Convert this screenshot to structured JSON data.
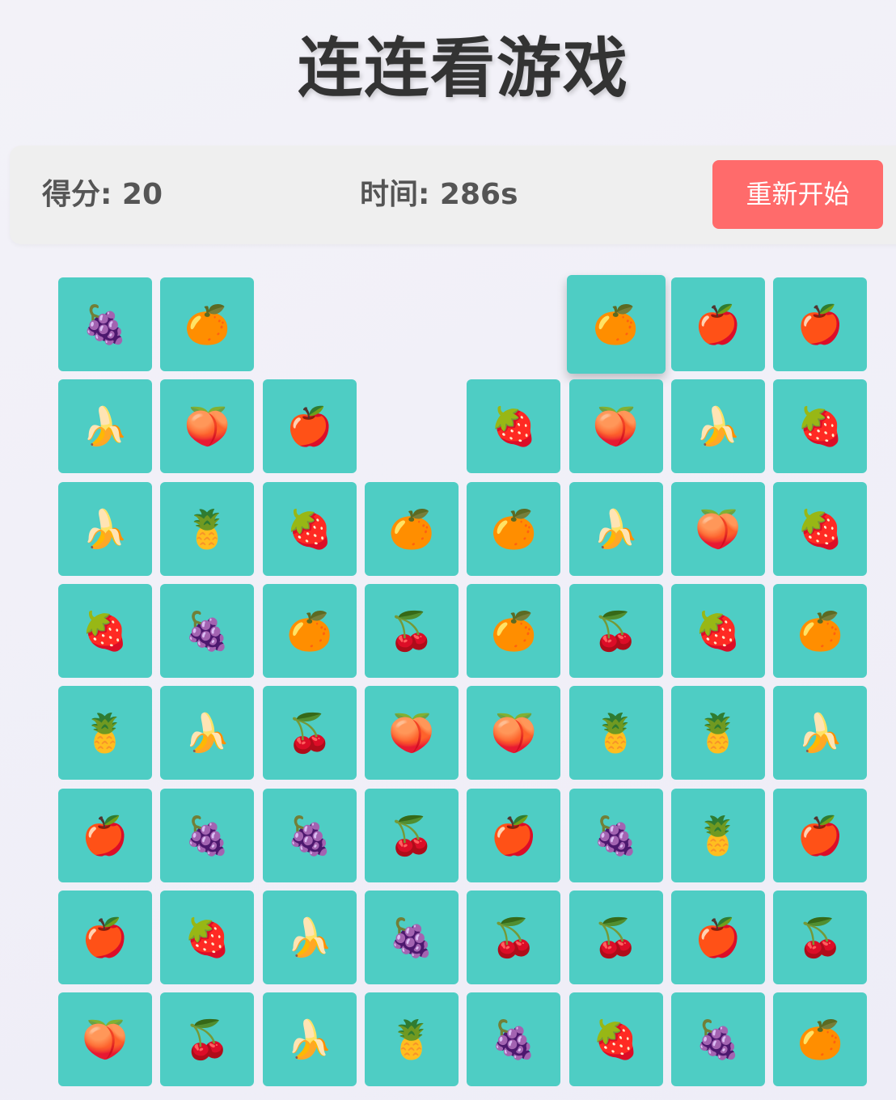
{
  "title": "连连看游戏",
  "score": {
    "label": "得分",
    "value": "20",
    "text": "得分: 20"
  },
  "timer": {
    "label": "时间",
    "value": "286s",
    "text": "时间: 286s"
  },
  "restart_button": {
    "label": "重新开始",
    "color": "#ff6b6b"
  },
  "tile_color": "#4ecdc4",
  "fruits": {
    "grapes": "🍇",
    "orange": "🍊",
    "apple": "🍎",
    "banana": "🍌",
    "peach": "🍑",
    "strawberry": "🍓",
    "pineapple": "🍍",
    "cherries": "🍒"
  },
  "board": {
    "rows": 8,
    "cols": 8,
    "selected": [
      0,
      5
    ],
    "grid": [
      [
        "grapes",
        "orange",
        null,
        null,
        null,
        "orange",
        "apple",
        "apple"
      ],
      [
        "banana",
        "peach",
        "apple",
        null,
        "strawberry",
        "peach",
        "banana",
        "strawberry"
      ],
      [
        "banana",
        "pineapple",
        "strawberry",
        "orange",
        "orange",
        "banana",
        "peach",
        "strawberry"
      ],
      [
        "strawberry",
        "grapes",
        "orange",
        "cherries",
        "orange",
        "cherries",
        "strawberry",
        "orange"
      ],
      [
        "pineapple",
        "banana",
        "cherries",
        "peach",
        "peach",
        "pineapple",
        "pineapple",
        "banana"
      ],
      [
        "apple",
        "grapes",
        "grapes",
        "cherries",
        "apple",
        "grapes",
        "pineapple",
        "apple"
      ],
      [
        "apple",
        "strawberry",
        "banana",
        "grapes",
        "cherries",
        "cherries",
        "apple",
        "cherries"
      ],
      [
        "peach",
        "cherries",
        "banana",
        "pineapple",
        "grapes",
        "strawberry",
        "grapes",
        "orange"
      ]
    ]
  }
}
